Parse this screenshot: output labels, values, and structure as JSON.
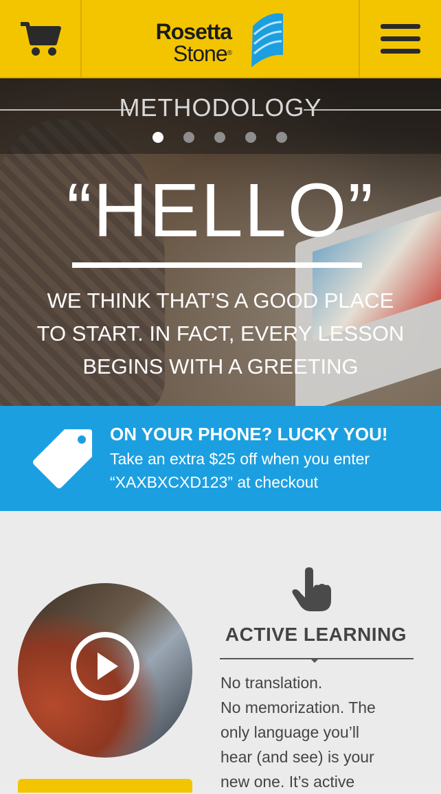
{
  "header": {
    "cart_icon": "shopping-cart-icon",
    "logo_line1": "Rosetta",
    "logo_line2": "Stone",
    "logo_reg": "®",
    "menu_icon": "hamburger-menu-icon",
    "colors": {
      "background": "#f3c500",
      "icon": "#2a2a2a",
      "logo_blue": "#1c9fe0"
    }
  },
  "hero": {
    "section_title": "METHODOLOGY",
    "slides": 5,
    "active_slide": 1,
    "headline": "“HELLO”",
    "body_line1": "WE THINK THAT’S A GOOD PLACE",
    "body_line2": "TO START. IN FACT, EVERY LESSON",
    "body_line3": "BEGINS WITH A GREETING"
  },
  "promo": {
    "icon": "price-tag-icon",
    "headline": "ON YOUR PHONE? LUCKY YOU!",
    "line1": "Take an extra $25 off when you enter",
    "line2": "“XAXBXCXD123” at checkout",
    "colors": {
      "background": "#1c9fe0",
      "text": "#ffffff"
    }
  },
  "feature": {
    "icon": "pointing-hand-icon",
    "video_icon": "play-icon",
    "title": "ACTIVE LEARNING",
    "body_lines": [
      "No translation.",
      "No memorization. The",
      "only language you’ll",
      "hear (and see) is your",
      "new one. It’s active"
    ]
  }
}
